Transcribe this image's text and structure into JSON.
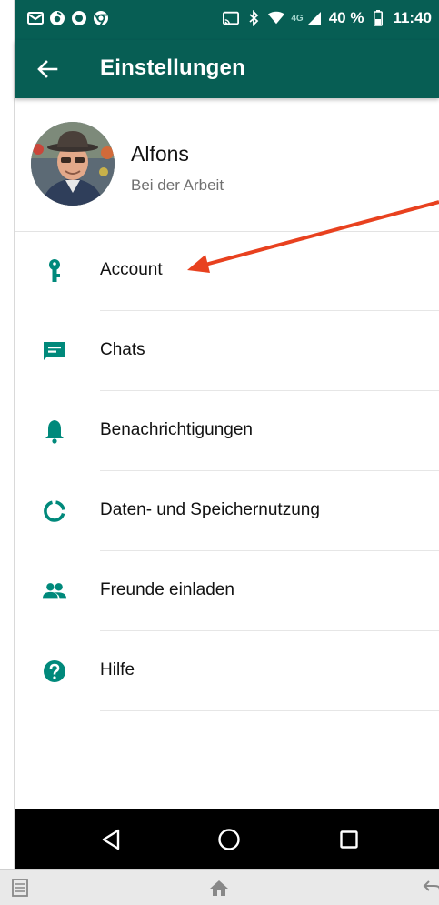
{
  "status_bar": {
    "network": "4G",
    "battery": "40 %",
    "time": "11:40",
    "icons": [
      "gmail-icon",
      "vodafone-icon",
      "record-icon",
      "chrome-icon",
      "cast-icon",
      "bluetooth-icon",
      "wifi-icon",
      "signal-icon",
      "battery-icon"
    ]
  },
  "app_bar": {
    "title": "Einstellungen",
    "back_icon": "arrow-back-icon"
  },
  "profile": {
    "name": "Alfons",
    "status": "Bei der Arbeit"
  },
  "menu": {
    "items": [
      {
        "label": "Account",
        "icon": "key-icon"
      },
      {
        "label": "Chats",
        "icon": "chat-icon"
      },
      {
        "label": "Benachrichtigungen",
        "icon": "bell-icon"
      },
      {
        "label": "Daten- und Speichernutzung",
        "icon": "data-usage-icon"
      },
      {
        "label": "Freunde einladen",
        "icon": "people-icon"
      },
      {
        "label": "Hilfe",
        "icon": "help-icon"
      }
    ]
  },
  "colors": {
    "primary_dark": "#075e54",
    "accent": "#00897b",
    "annotation_arrow": "#e8411f"
  },
  "nav_bar": {
    "buttons": [
      "back-triangle-icon",
      "home-circle-icon",
      "recents-square-icon"
    ]
  },
  "bottom_toolbar": {
    "icons": [
      "menu-doc-icon",
      "home-icon",
      "undo-icon"
    ]
  }
}
